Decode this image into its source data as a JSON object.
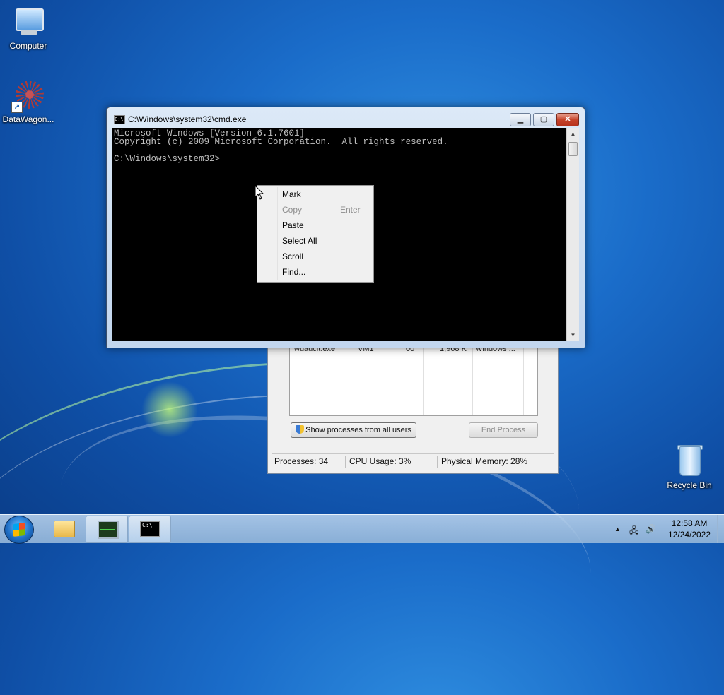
{
  "desktop": {
    "icons": [
      {
        "label": "Computer",
        "icon": "computer-icon"
      },
      {
        "label": "DataWagon...",
        "icon": "datawagon-icon"
      },
      {
        "label": "Recycle Bin",
        "icon": "recycle-bin-icon"
      }
    ]
  },
  "task_manager": {
    "row": {
      "name": "wuauclt.exe",
      "user": "VM1",
      "cpu": "00",
      "mem": "1,968 K",
      "desc": "Windows ..."
    },
    "show_all_label": "Show processes from all users",
    "end_process_label": "End Process",
    "status": {
      "processes": "Processes: 34",
      "cpu": "CPU Usage: 3%",
      "memory": "Physical Memory: 28%"
    }
  },
  "cmd_window": {
    "title": "C:\\Windows\\system32\\cmd.exe",
    "icon_text": "C:\\",
    "minimize_label": "▁",
    "maximize_label": "▢",
    "close_label": "✕",
    "console_text": "Microsoft Windows [Version 6.1.7601]\nCopyright (c) 2009 Microsoft Corporation.  All rights reserved.\n\nC:\\Windows\\system32>"
  },
  "context_menu": {
    "items": [
      {
        "label": "Mark",
        "accel": "",
        "enabled": true
      },
      {
        "label": "Copy",
        "accel": "Enter",
        "enabled": false
      },
      {
        "label": "Paste",
        "accel": "",
        "enabled": true
      },
      {
        "label": "Select All",
        "accel": "",
        "enabled": true
      },
      {
        "label": "Scroll",
        "accel": "",
        "enabled": true
      },
      {
        "label": "Find...",
        "accel": "",
        "enabled": true
      }
    ]
  },
  "taskbar": {
    "cmd_icon_text": "C:\\_",
    "clock": {
      "time": "12:58 AM",
      "date": "12/24/2022"
    },
    "tray_arrow": "▲",
    "network_glyph": "🖧",
    "volume_glyph": "🔊"
  }
}
